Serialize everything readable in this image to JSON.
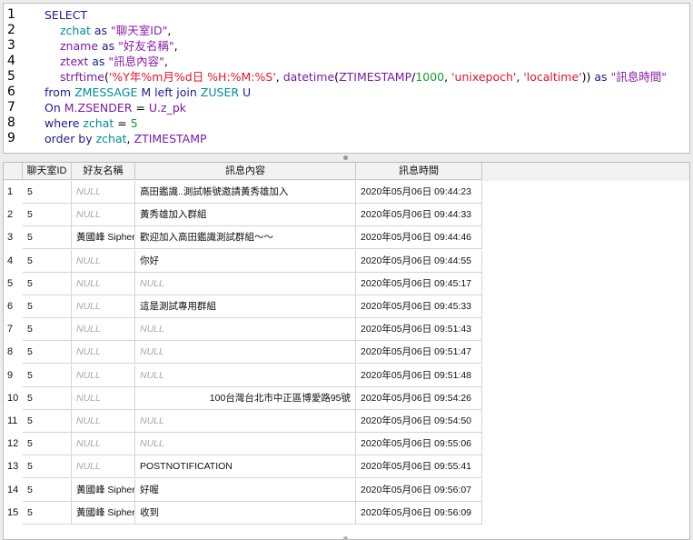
{
  "editor": {
    "line_numbers": [
      "1",
      "2",
      "3",
      "4",
      "5",
      "6",
      "7",
      "8",
      "9"
    ],
    "lines": [
      [
        {
          "t": "SELECT",
          "c": "kw"
        }
      ],
      [
        {
          "t": "zchat",
          "c": "id"
        },
        {
          "t": " as ",
          "c": "kw"
        },
        {
          "t": "\"聊天室ID\"",
          "c": "str"
        },
        {
          "t": ",",
          "c": ""
        }
      ],
      [
        {
          "t": "zname",
          "c": "fn"
        },
        {
          "t": " as ",
          "c": "kw"
        },
        {
          "t": "\"好友名稱\"",
          "c": "str"
        },
        {
          "t": ",",
          "c": ""
        }
      ],
      [
        {
          "t": "ztext",
          "c": "fn"
        },
        {
          "t": " as ",
          "c": "kw"
        },
        {
          "t": "\"訊息內容\"",
          "c": "str"
        },
        {
          "t": ",",
          "c": ""
        }
      ],
      [
        {
          "t": "strftime",
          "c": "fn"
        },
        {
          "t": "(",
          "c": ""
        },
        {
          "t": "'%Y年%m月%d日 %H:%M:%S'",
          "c": "red"
        },
        {
          "t": ", ",
          "c": ""
        },
        {
          "t": "datetime",
          "c": "fn"
        },
        {
          "t": "(",
          "c": ""
        },
        {
          "t": "ZTIMESTAMP",
          "c": "fn"
        },
        {
          "t": "/",
          "c": ""
        },
        {
          "t": "1000",
          "c": "num"
        },
        {
          "t": ", ",
          "c": ""
        },
        {
          "t": "'unixepoch'",
          "c": "red"
        },
        {
          "t": ", ",
          "c": ""
        },
        {
          "t": "'localtime'",
          "c": "red"
        },
        {
          "t": "))",
          "c": ""
        },
        {
          "t": " as ",
          "c": "kw"
        },
        {
          "t": "\"訊息時間\"",
          "c": "str"
        }
      ],
      [
        {
          "t": "from ",
          "c": "kw"
        },
        {
          "t": "ZMESSAGE",
          "c": "tbl"
        },
        {
          "t": " M ",
          "c": "kw"
        },
        {
          "t": "left join ",
          "c": "kw"
        },
        {
          "t": "ZUSER",
          "c": "tbl"
        },
        {
          "t": " U",
          "c": "kw"
        }
      ],
      [
        {
          "t": "On ",
          "c": "kw"
        },
        {
          "t": "M.ZSENDER",
          "c": "fn"
        },
        {
          "t": " = ",
          "c": ""
        },
        {
          "t": "U.z_pk",
          "c": "fn"
        }
      ],
      [
        {
          "t": "where ",
          "c": "kw"
        },
        {
          "t": "zchat",
          "c": "id"
        },
        {
          "t": " = ",
          "c": ""
        },
        {
          "t": "5",
          "c": "num"
        }
      ],
      [
        {
          "t": "order by ",
          "c": "kw"
        },
        {
          "t": "zchat",
          "c": "id"
        },
        {
          "t": ", ",
          "c": ""
        },
        {
          "t": "ZTIMESTAMP",
          "c": "fn"
        }
      ]
    ],
    "indented": [
      false,
      true,
      true,
      true,
      true,
      false,
      false,
      false,
      false
    ]
  },
  "grid": {
    "headers": [
      "聊天室ID",
      "好友名稱",
      "訊息內容",
      "訊息時間"
    ],
    "null_label": "NULL",
    "rows": [
      {
        "n": "1",
        "id": "5",
        "name": null,
        "text": "高田鑑識..測試帳號邀請黃秀雄加入",
        "text_right": false,
        "time": "2020年05月06日 09:44:23"
      },
      {
        "n": "2",
        "id": "5",
        "name": null,
        "text": "黃秀雄加入群組",
        "text_right": false,
        "time": "2020年05月06日 09:44:33"
      },
      {
        "n": "3",
        "id": "5",
        "name": "黃國峰 Sipher",
        "text": "歡迎加入高田鑑識測試群組～～",
        "text_right": false,
        "time": "2020年05月06日 09:44:46"
      },
      {
        "n": "4",
        "id": "5",
        "name": null,
        "text": "你好",
        "text_right": false,
        "time": "2020年05月06日 09:44:55"
      },
      {
        "n": "5",
        "id": "5",
        "name": null,
        "text": null,
        "text_right": false,
        "time": "2020年05月06日 09:45:17"
      },
      {
        "n": "6",
        "id": "5",
        "name": null,
        "text": "這是測試專用群組",
        "text_right": false,
        "time": "2020年05月06日 09:45:33"
      },
      {
        "n": "7",
        "id": "5",
        "name": null,
        "text": null,
        "text_right": false,
        "time": "2020年05月06日 09:51:43"
      },
      {
        "n": "8",
        "id": "5",
        "name": null,
        "text": null,
        "text_right": false,
        "time": "2020年05月06日 09:51:47"
      },
      {
        "n": "9",
        "id": "5",
        "name": null,
        "text": null,
        "text_right": false,
        "time": "2020年05月06日 09:51:48"
      },
      {
        "n": "10",
        "id": "5",
        "name": null,
        "text": "100台灣台北市中正區博愛路95號",
        "text_right": true,
        "time": "2020年05月06日 09:54:26"
      },
      {
        "n": "11",
        "id": "5",
        "name": null,
        "text": null,
        "text_right": false,
        "time": "2020年05月06日 09:54:50"
      },
      {
        "n": "12",
        "id": "5",
        "name": null,
        "text": null,
        "text_right": false,
        "time": "2020年05月06日 09:55:06"
      },
      {
        "n": "13",
        "id": "5",
        "name": null,
        "text": "POSTNOTIFICATION",
        "text_right": false,
        "time": "2020年05月06日 09:55:41"
      },
      {
        "n": "14",
        "id": "5",
        "name": "黃國峰 Sipher",
        "text": "好喔",
        "text_right": false,
        "time": "2020年05月06日 09:56:07"
      },
      {
        "n": "15",
        "id": "5",
        "name": "黃國峰 Sipher",
        "text": "收到",
        "text_right": false,
        "time": "2020年05月06日 09:56:09"
      }
    ]
  }
}
